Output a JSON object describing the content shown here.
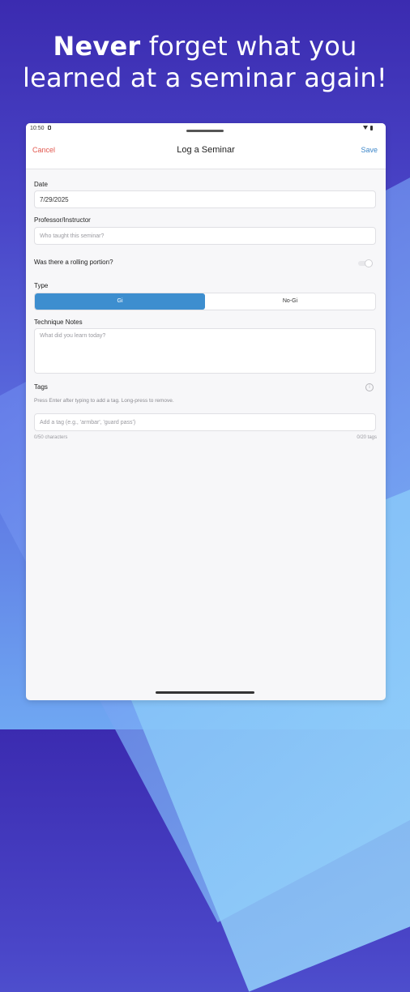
{
  "headline": {
    "bold": "Never",
    "rest": " forget what you learned at a seminar again!"
  },
  "status_bar": {
    "time": "10:50"
  },
  "navbar": {
    "cancel": "Cancel",
    "title": "Log a Seminar",
    "save": "Save"
  },
  "form": {
    "date": {
      "label": "Date",
      "value": "7/29/2025"
    },
    "professor": {
      "label": "Professor/Instructor",
      "placeholder": "Who taught this seminar?"
    },
    "rolling": {
      "label": "Was there a rolling portion?",
      "on": false
    },
    "type": {
      "label": "Type",
      "options": [
        "Gi",
        "No-Gi"
      ],
      "selected": "Gi"
    },
    "notes": {
      "label": "Technique Notes",
      "placeholder": "What did you learn today?"
    },
    "tags": {
      "label": "Tags",
      "helper": "Press Enter after typing to add a tag. Long-press to remove.",
      "placeholder": "Add a tag (e.g., 'armbar', 'guard pass')",
      "char_count": "0/50 characters",
      "tag_count": "0/20 tags"
    }
  },
  "colors": {
    "accent": "#3d8ecf",
    "cancel": "#e2584e",
    "save": "#3c86c9"
  }
}
